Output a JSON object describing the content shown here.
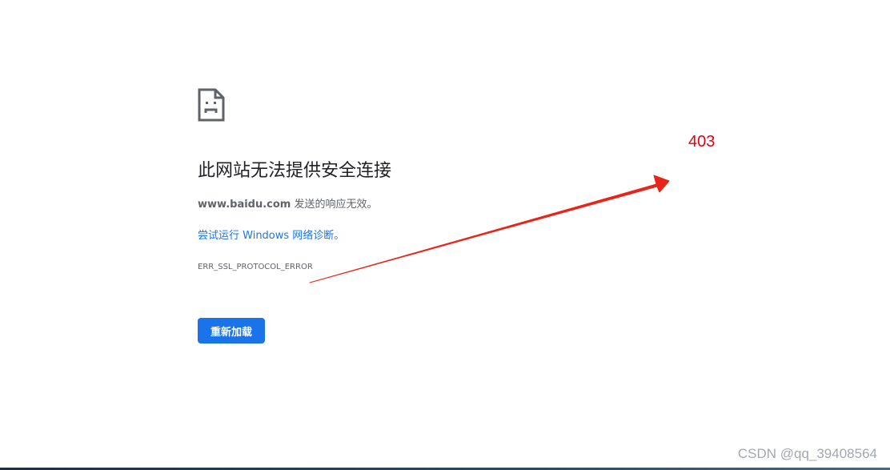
{
  "error_page": {
    "title": "此网站无法提供安全连接",
    "domain": "www.baidu.com",
    "description_suffix": " 发送的响应无效。",
    "diagnostics_link": "尝试运行 Windows 网络诊断",
    "diagnostics_period": "。",
    "error_code": "ERR_SSL_PROTOCOL_ERROR",
    "reload_label": "重新加载",
    "icon": "broken-page-sad-icon"
  },
  "annotation": {
    "label": "403",
    "color": "#e60012"
  },
  "watermark": {
    "text": "CSDN @qq_39408564"
  },
  "colors": {
    "accent": "#1a73e8",
    "text_primary": "#202124",
    "text_secondary": "#5f6368"
  }
}
